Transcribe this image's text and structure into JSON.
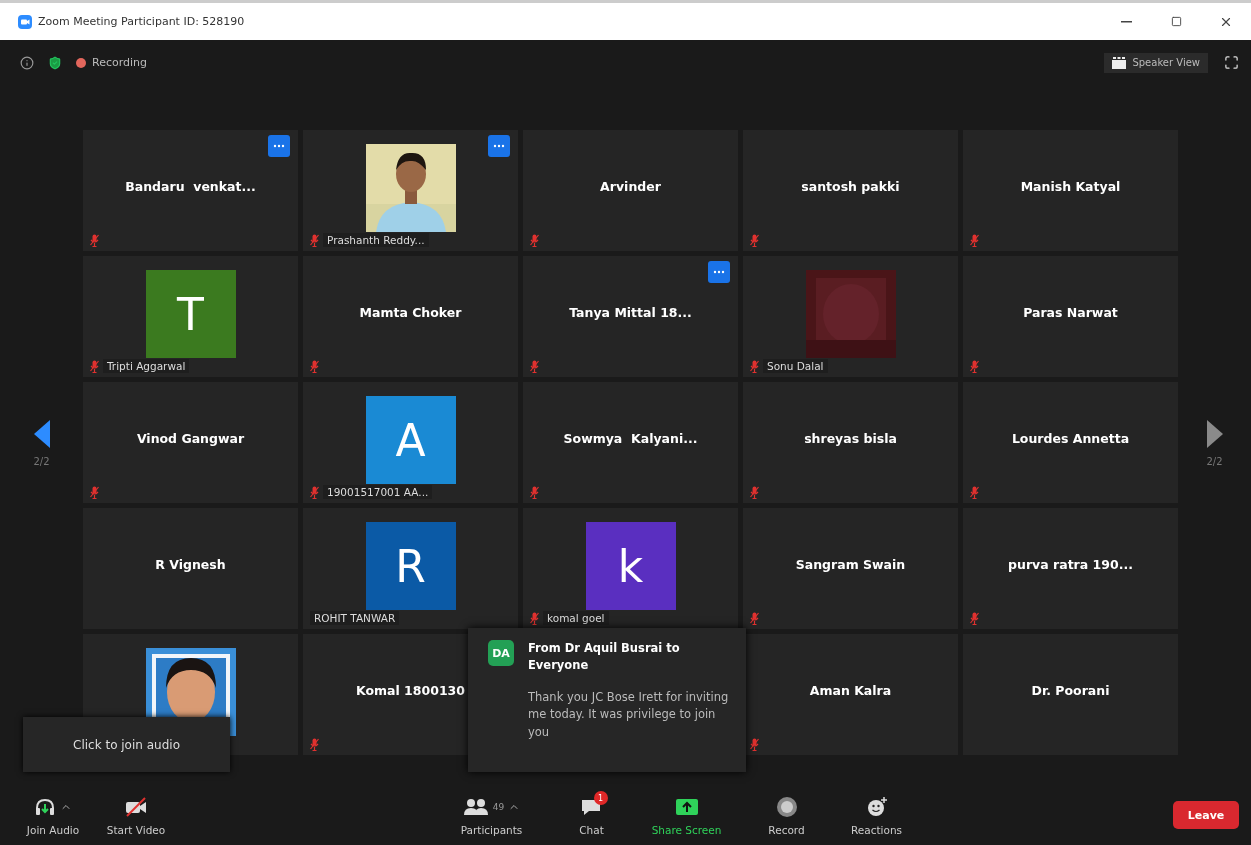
{
  "window": {
    "title": "Zoom Meeting Participant ID: 528190"
  },
  "top_bar": {
    "recording_label": "Recording",
    "view_button": "Speaker View"
  },
  "pager": {
    "previous": {
      "label": "2/2",
      "disabled": false
    },
    "next": {
      "label": "2/2",
      "disabled": true
    }
  },
  "tiles": [
    {
      "kind": "name",
      "name": "Bandaru  venkat...",
      "muted": true,
      "menu": true
    },
    {
      "kind": "picture",
      "label": "Prashanth Reddy...",
      "muted": true,
      "menu": true
    },
    {
      "kind": "name",
      "name": "Arvinder",
      "muted": true,
      "menu": false
    },
    {
      "kind": "name",
      "name": "santosh pakki",
      "muted": true,
      "menu": false
    },
    {
      "kind": "name",
      "name": "Manish Katyal",
      "muted": true,
      "menu": false
    },
    {
      "kind": "avatar",
      "letter": "T",
      "color": "#3b7a1f",
      "label": "Tripti Aggarwal",
      "muted": true,
      "menu": false
    },
    {
      "kind": "name",
      "name": "Mamta Choker",
      "muted": true,
      "menu": false
    },
    {
      "kind": "name",
      "name": "Tanya Mittal 18...",
      "muted": true,
      "menu": true
    },
    {
      "kind": "picture",
      "label": "Sonu Dalal",
      "muted": true,
      "menu": false
    },
    {
      "kind": "name",
      "name": "Paras Narwat",
      "muted": true,
      "menu": false
    },
    {
      "kind": "name",
      "name": "Vinod Gangwar",
      "muted": true,
      "menu": false
    },
    {
      "kind": "avatar",
      "letter": "A",
      "color": "#1a8ad4",
      "label": "19001517001 AA...",
      "muted": true,
      "menu": false
    },
    {
      "kind": "name",
      "name": "Sowmya  Kalyani...",
      "muted": true,
      "menu": false
    },
    {
      "kind": "name",
      "name": "shreyas bisla",
      "muted": true,
      "menu": false
    },
    {
      "kind": "name",
      "name": "Lourdes Annetta",
      "muted": true,
      "menu": false
    },
    {
      "kind": "name",
      "name": "R Vignesh",
      "muted": false,
      "menu": false
    },
    {
      "kind": "avatar",
      "letter": "R",
      "color": "#0b5aa6",
      "label": "ROHIT TANWAR",
      "muted": false,
      "menu": false
    },
    {
      "kind": "avatar",
      "letter": "k",
      "color": "#5a2fc0",
      "label": "komal goel",
      "muted": true,
      "menu": false
    },
    {
      "kind": "name",
      "name": "Sangram Swain",
      "muted": true,
      "menu": false
    },
    {
      "kind": "name",
      "name": "purva ratra 190...",
      "muted": true,
      "menu": false
    },
    {
      "kind": "picture",
      "muted": false,
      "menu": false
    },
    {
      "kind": "name",
      "name": "Komal 1800130",
      "muted": true,
      "menu": false
    },
    {
      "kind": "blank"
    },
    {
      "kind": "name",
      "name": "Aman Kalra",
      "muted": true,
      "menu": false
    },
    {
      "kind": "name",
      "name": "Dr. Poorani",
      "muted": false,
      "menu": false
    }
  ],
  "tooltip": "Click to join audio",
  "chat_popup": {
    "avatar": "DA",
    "title": "From Dr Aquil Busrai to Everyone",
    "message": "Thank you JC Bose Irett for inviting me today. It was privilege to join you"
  },
  "toolbar": [
    {
      "kind": "audio",
      "label": "Join Audio",
      "caret": true
    },
    {
      "kind": "video",
      "label": "Start Video",
      "caret": false
    },
    {
      "kind": "participants",
      "label": "Participants",
      "count": "49",
      "caret": true
    },
    {
      "kind": "chat",
      "label": "Chat",
      "badge": "1",
      "caret": false
    },
    {
      "kind": "share",
      "label": "Share Screen",
      "caret": false
    },
    {
      "kind": "record",
      "label": "Record",
      "caret": false
    },
    {
      "kind": "reactions",
      "label": "Reactions",
      "caret": false
    }
  ],
  "leave_button": "Leave"
}
